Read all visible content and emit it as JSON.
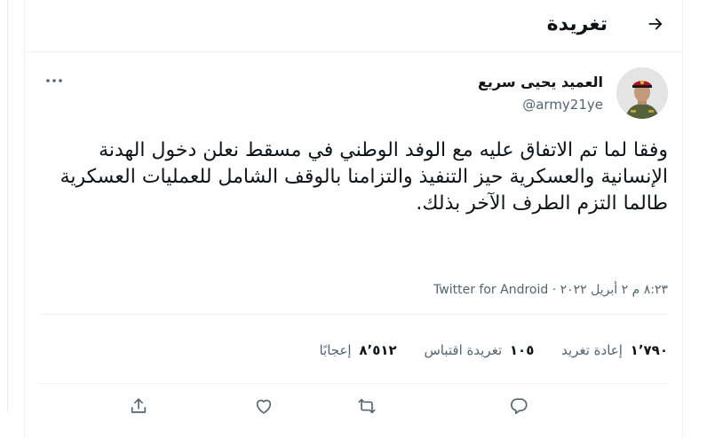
{
  "header": {
    "title": "تغريدة",
    "back_icon": "arrow-right-icon"
  },
  "author": {
    "name": "العميد يحيى سريع",
    "handle": "@army21ye",
    "more_icon": "more-icon"
  },
  "tweet": {
    "text": "وفقا لما تم الاتفاق عليه مع الوفد الوطني في مسقط نعلن دخول الهدنة الإنسانية والعسكرية حيز التنفيذ والتزامنا بالوقف الشامل للعمليات العسكرية طالما التزم الطرف الآخر بذلك."
  },
  "meta": {
    "time": "٨:٢٣ م",
    "date": "٢ أبريل ٢٠٢٢",
    "client": "Twitter for Android",
    "separator": "·"
  },
  "stats": {
    "retweets": {
      "count": "١٬٧٩٠",
      "label": "إعادة تغريد"
    },
    "quotes": {
      "count": "١٠٥",
      "label": "تغريدة اقتباس"
    },
    "likes": {
      "count": "٨٬٥١٢",
      "label": "إعجابًا"
    }
  },
  "actions": [
    "reply-icon",
    "retweet-icon",
    "like-icon",
    "share-icon"
  ],
  "colors": {
    "text": "#0f1419",
    "secondary": "#536471",
    "border": "#eff3f4"
  }
}
